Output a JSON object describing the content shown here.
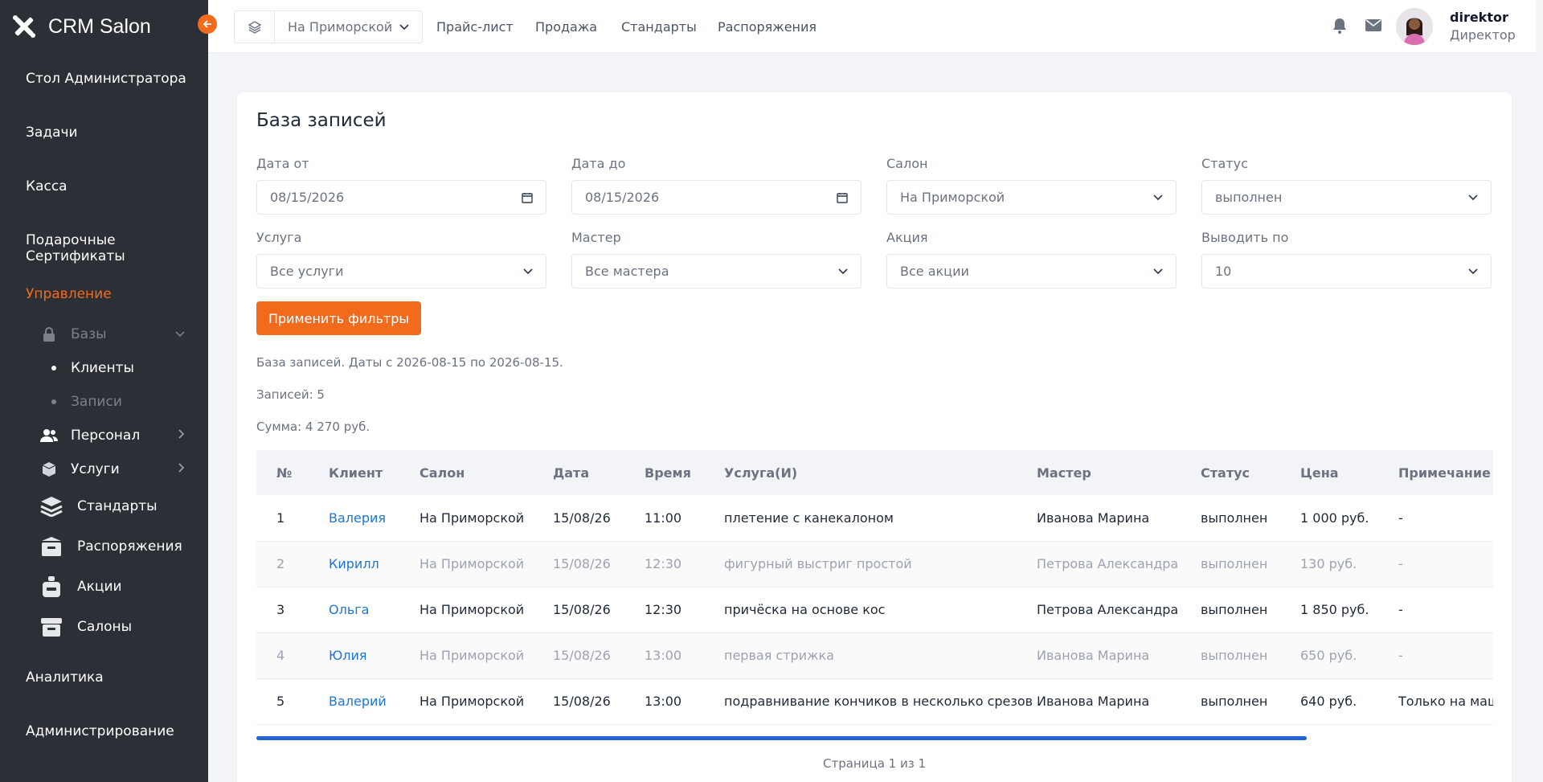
{
  "brand": {
    "name": "CRM Salon"
  },
  "sidebar": {
    "items": [
      {
        "label": "Стол Администратора"
      },
      {
        "label": "Задачи"
      },
      {
        "label": "Касса"
      },
      {
        "label": "Подарочные Сертификаты"
      },
      {
        "label": "Управление"
      },
      {
        "label": "Аналитика"
      },
      {
        "label": "Администрирование"
      }
    ],
    "bases_label": "Базы",
    "leaves": [
      {
        "label": "Клиенты"
      },
      {
        "label": "Записи"
      }
    ],
    "groups": [
      {
        "label": "Персонал"
      },
      {
        "label": "Услуги"
      }
    ],
    "sections": [
      {
        "label": "Стандарты"
      },
      {
        "label": "Распоряжения"
      },
      {
        "label": "Акции"
      },
      {
        "label": "Салоны"
      }
    ],
    "accent": "#f26b1d"
  },
  "topbar": {
    "salon": "На Приморской",
    "nav": [
      "Прайс-лист",
      "Продажа",
      "Стандарты",
      "Распоряжения"
    ],
    "user_name": "direktor",
    "user_role": "Директор"
  },
  "page": {
    "title": "База записей",
    "filters": {
      "date_from": {
        "label": "Дата от",
        "value": "08/15/2026"
      },
      "date_to": {
        "label": "Дата до",
        "value": "08/15/2026"
      },
      "salon": {
        "label": "Салон",
        "value": "На Приморской"
      },
      "status": {
        "label": "Статус",
        "value": "выполнен"
      },
      "service": {
        "label": "Услуга",
        "value": "Все услуги"
      },
      "master": {
        "label": "Мастер",
        "value": "Все мастера"
      },
      "promo": {
        "label": "Акция",
        "value": "Все акции"
      },
      "per_page": {
        "label": "Выводить по",
        "value": "10"
      }
    },
    "apply_label": "Применить фильтры",
    "info_dates": "База записей. Даты с 2026-08-15 по 2026-08-15.",
    "info_count": "Записей: 5",
    "info_sum": "Сумма: 4 270 руб.",
    "pager": "Страница 1 из 1"
  },
  "table": {
    "headers": [
      "№",
      "Клиент",
      "Салон",
      "Дата",
      "Время",
      "Услуга(И)",
      "Мастер",
      "Статус",
      "Цена",
      "Примечание"
    ],
    "rows": [
      [
        "1",
        "Валерия",
        "На Приморской",
        "15/08/26",
        "11:00",
        "плетение с канекалоном",
        "Иванова Марина",
        "выполнен",
        "1 000 руб.",
        "-"
      ],
      [
        "2",
        "Кирилл",
        "На Приморской",
        "15/08/26",
        "12:30",
        "фигурный выстриг простой",
        "Петрова Александра",
        "выполнен",
        "130 руб.",
        "-"
      ],
      [
        "3",
        "Ольга",
        "На Приморской",
        "15/08/26",
        "12:30",
        "причёска на основе кос",
        "Петрова Александра",
        "выполнен",
        "1 850 руб.",
        "-"
      ],
      [
        "4",
        "Юлия",
        "На Приморской",
        "15/08/26",
        "13:00",
        "первая стрижка",
        "Иванова Марина",
        "выполнен",
        "650 руб.",
        "-"
      ],
      [
        "5",
        "Валерий",
        "На Приморской",
        "15/08/26",
        "13:00",
        "подравнивание кончиков в несколько срезов",
        "Иванова Марина",
        "выполнен",
        "640 руб.",
        "Только на маши"
      ]
    ]
  }
}
